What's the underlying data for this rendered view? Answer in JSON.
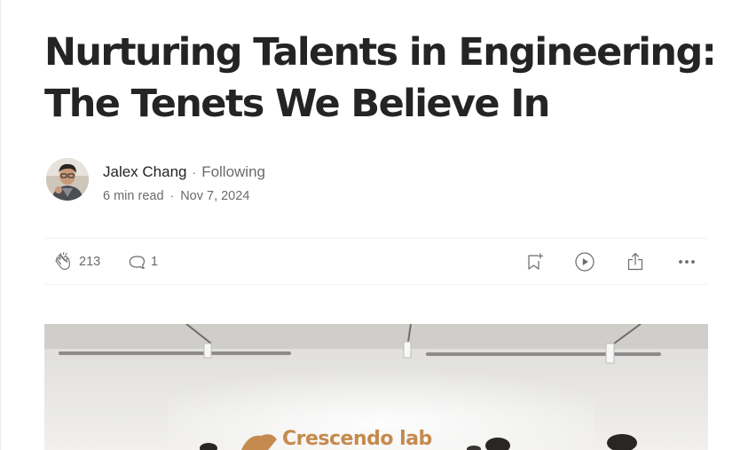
{
  "article": {
    "title_line1": "Nurturing Talents in Engineering:",
    "title_line2": "The Tenets We Believe In"
  },
  "author": {
    "name": "Jalex Chang",
    "follow_label": "Following",
    "read_time": "6 min read",
    "date": "Nov 7, 2024"
  },
  "actions": {
    "clap_count": "213",
    "response_count": "1",
    "icons": [
      "clap-icon",
      "response-icon",
      "bookmark-icon",
      "listen-icon",
      "share-icon",
      "more-icon"
    ]
  },
  "hero": {
    "brand_text": "Crescendo lab"
  },
  "colors": {
    "text_primary": "#242424",
    "text_secondary": "#6b6b6b",
    "divider": "#f2f2f2",
    "brand_orange": "#c48a4e"
  }
}
